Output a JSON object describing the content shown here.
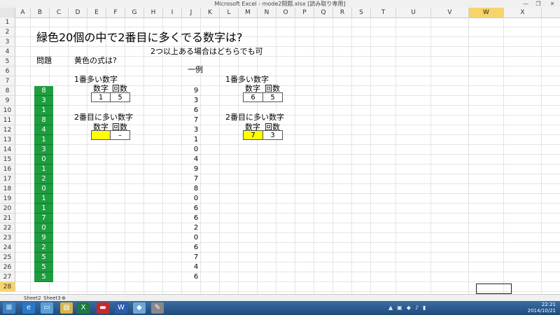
{
  "window": {
    "title": "Microsoft Excel - mode2問題.xlsx [読み取り専用]",
    "minimize": "—",
    "maximize": "❐",
    "close": "✕"
  },
  "columns": [
    "A",
    "B",
    "C",
    "D",
    "E",
    "F",
    "G",
    "H",
    "I",
    "J",
    "K",
    "L",
    "M",
    "N",
    "O",
    "P",
    "Q",
    "R",
    "S",
    "T",
    "U",
    "V",
    "W",
    "X"
  ],
  "selected_column": "W",
  "rows": [
    "1",
    "2",
    "3",
    "4",
    "5",
    "6",
    "7",
    "8",
    "9",
    "10",
    "11",
    "12",
    "13",
    "14",
    "15",
    "16",
    "17",
    "18",
    "19",
    "20",
    "21",
    "22",
    "23",
    "24",
    "25",
    "26",
    "27",
    "28"
  ],
  "selected_row": "28",
  "sheet": {
    "title": "緑色20個の中で2番目に多くでる数字は?",
    "note": "2つ以上ある場合はどちらでも可",
    "label_problem": "問題",
    "label_question": "黄色の式は?",
    "label_example": "一例",
    "first_most_label": "1番多い数字",
    "second_most_label": "2番目に多い数字",
    "num_label": "数字",
    "count_label": "回数",
    "first_num": "1",
    "first_count": "5",
    "second_num": "",
    "second_count": "–",
    "ex_first_num": "6",
    "ex_first_count": "5",
    "ex_second_num": "7",
    "ex_second_count": "3",
    "green_values": [
      "8",
      "3",
      "1",
      "8",
      "4",
      "1",
      "3",
      "0",
      "1",
      "2",
      "0",
      "1",
      "1",
      "7",
      "0",
      "9",
      "2",
      "5",
      "5",
      "5"
    ],
    "example_values": [
      "9",
      "3",
      "6",
      "7",
      "3",
      "1",
      "0",
      "4",
      "9",
      "7",
      "8",
      "0",
      "6",
      "6",
      "2",
      "0",
      "6",
      "7",
      "4",
      "6"
    ]
  },
  "tabs": [
    "Sheet2",
    "Sheet3"
  ],
  "tray": {
    "time": "22:21",
    "date": "2014/10/21"
  },
  "colors": {
    "green": "#1e9d3f",
    "yellow": "#ffff00",
    "taskbar": "#2d5a8a"
  }
}
